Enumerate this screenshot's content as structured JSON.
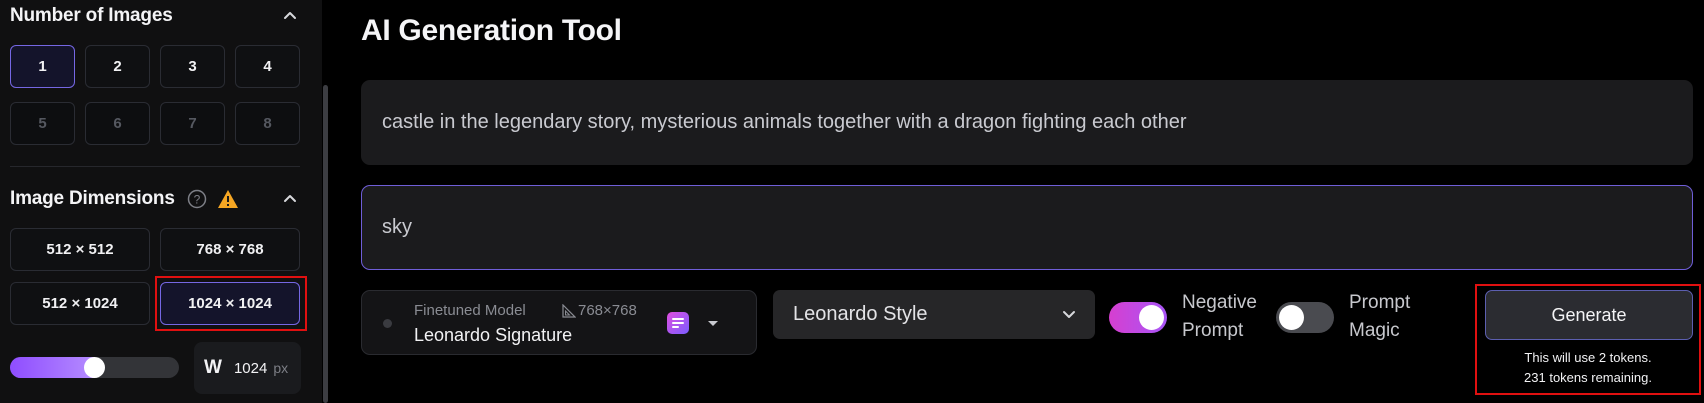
{
  "left_panel": {
    "number_of_images": {
      "title": "Number of Images",
      "options": [
        "1",
        "2",
        "3",
        "4",
        "5",
        "6",
        "7",
        "8"
      ],
      "selected": "1"
    },
    "image_dimensions": {
      "title": "Image Dimensions",
      "options": [
        "512 × 512",
        "768 × 768",
        "512 × 1024",
        "1024 × 1024"
      ],
      "selected": "1024 × 1024"
    },
    "width": {
      "label": "W",
      "value": "1024",
      "unit": "px",
      "slider_fraction": 0.5
    }
  },
  "main": {
    "title": "AI Generation Tool",
    "prompt": "castle in the legendary story, mysterious animals together with a dragon fighting each other",
    "negative_prompt": "sky",
    "model": {
      "caption": "Finetuned Model",
      "resolution": "768×768",
      "name": "Leonardo Signature"
    },
    "style": {
      "selected": "Leonardo Style"
    },
    "negative_prompt_toggle": {
      "line1": "Negative",
      "line2": "Prompt",
      "on": true
    },
    "prompt_magic_toggle": {
      "line1": "Prompt",
      "line2": "Magic",
      "on": false
    },
    "generate": {
      "label": "Generate",
      "cost_note": "This will use 2 tokens.",
      "remaining_note": "231 tokens remaining."
    }
  },
  "colors": {
    "accent": "#7567e3",
    "highlight_box": "#e01010",
    "toggle_on": "#a855f7",
    "warning": "#f5a623"
  }
}
